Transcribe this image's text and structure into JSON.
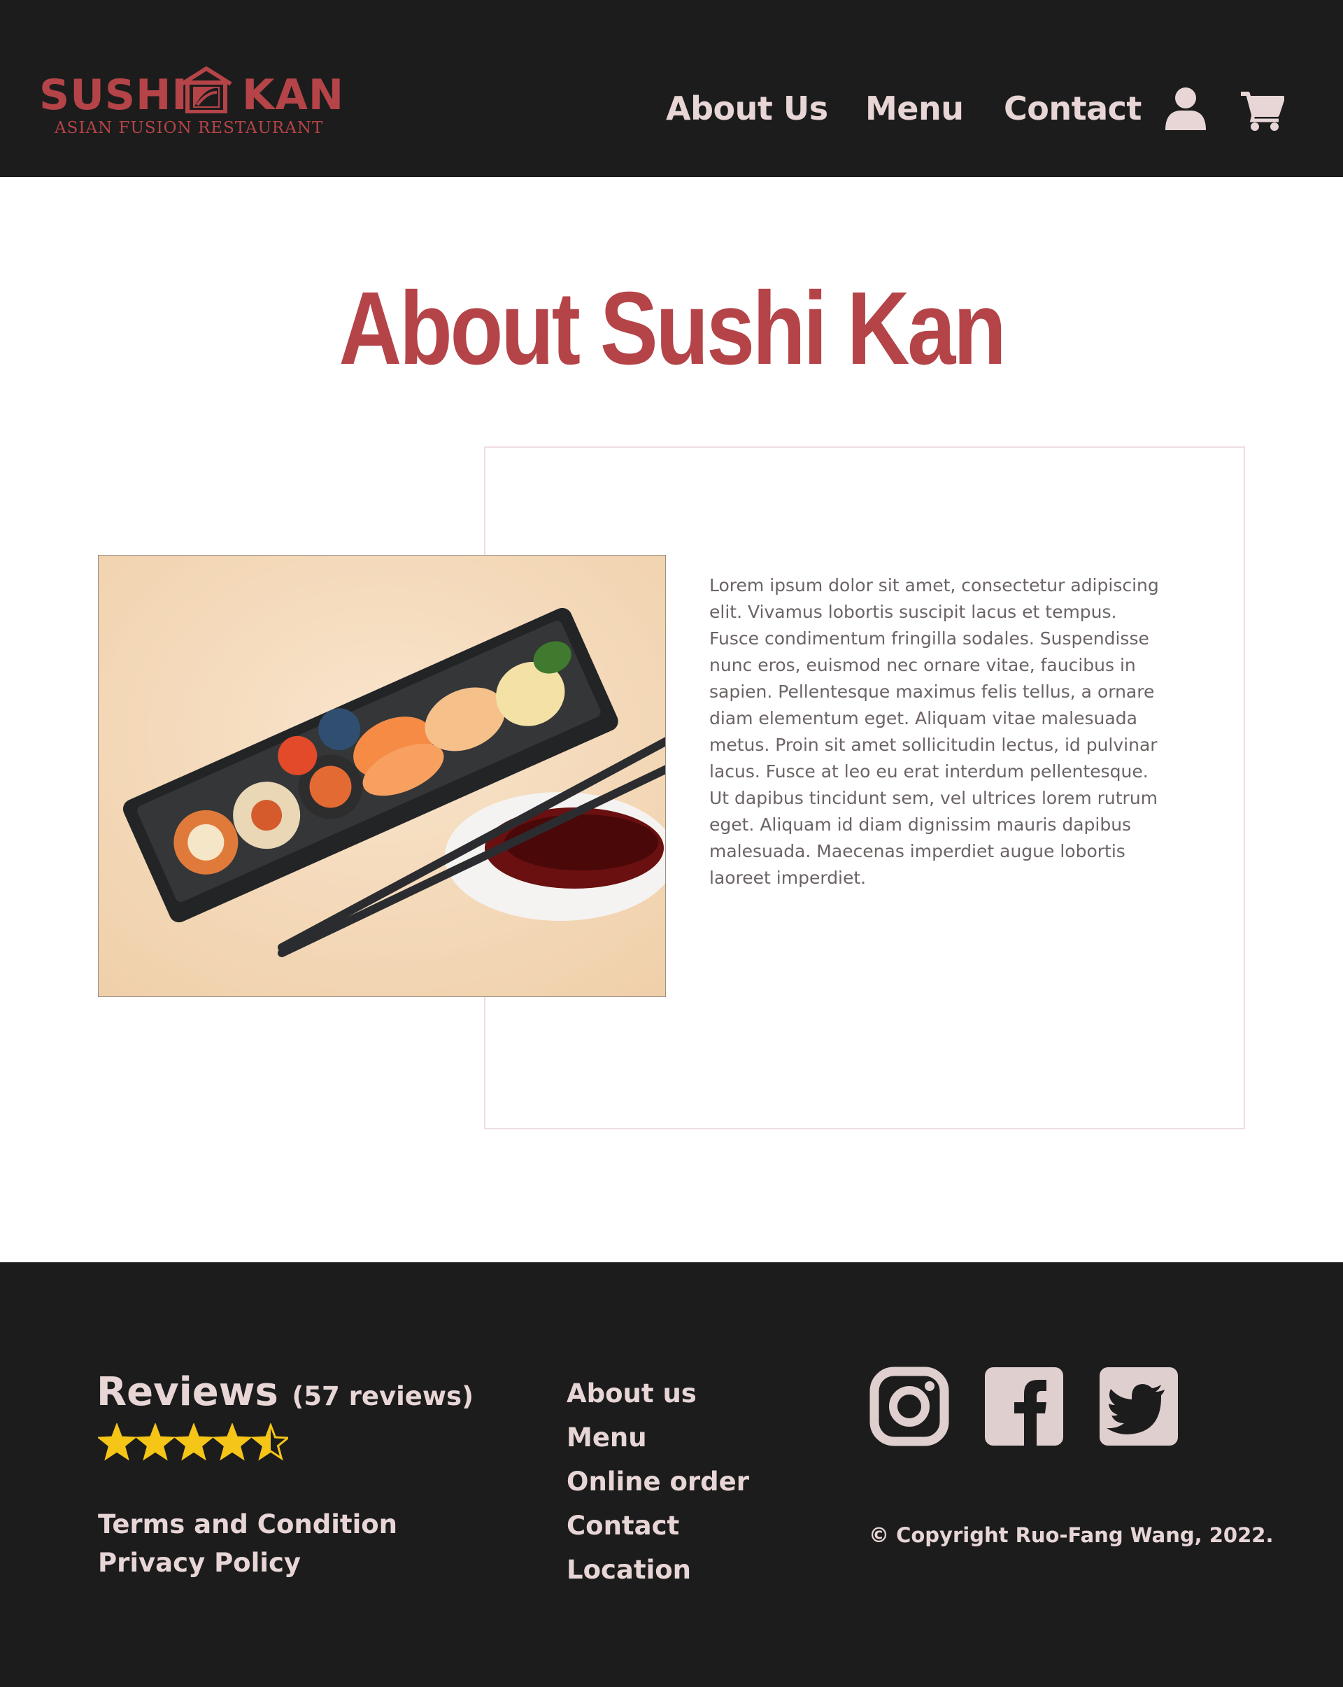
{
  "colors": {
    "header_bg": "#1c1c1c",
    "brand_red": "#b44448",
    "nav_text": "#e8d6d6",
    "star": "#f5c518",
    "body_text": "#6c6464"
  },
  "header": {
    "logo": {
      "word_left": "SUSHI",
      "word_right": "KAN",
      "tagline": "ASIAN FUSION RESTAURANT"
    },
    "nav": [
      {
        "label": "About Us"
      },
      {
        "label": "Menu"
      },
      {
        "label": "Contact"
      }
    ],
    "icons": [
      "user-icon",
      "cart-icon"
    ]
  },
  "main": {
    "title": "About Sushi Kan",
    "paragraph": "Lorem ipsum dolor sit amet, consectetur adipiscing elit. Vivamus lobortis suscipit lacus et tempus. Fusce condimentum fringilla sodales. Suspendisse nunc eros, euismod nec ornare vitae, faucibus in sapien. Pellentesque maximus felis tellus, a ornare diam elementum eget. Aliquam vitae malesuada metus. Proin sit amet sollicitudin lectus, id pulvinar lacus. Fusce at leo eu erat interdum pellentesque. Ut dapibus tincidunt sem, vel ultrices lorem rutrum eget. Aliquam id diam dignissim mauris dapibus malesuada. Maecenas imperdiet augue lobortis laoreet imperdiet."
  },
  "footer": {
    "reviews": {
      "title": "Reviews",
      "count": "(57 reviews)",
      "rating": 4.5,
      "max": 5
    },
    "legal": {
      "terms": "Terms and Condition",
      "privacy": "Privacy Policy"
    },
    "links": [
      {
        "label": "About us"
      },
      {
        "label": "Menu"
      },
      {
        "label": "Online order"
      },
      {
        "label": "Contact"
      },
      {
        "label": "Location"
      }
    ],
    "social": [
      "instagram-icon",
      "facebook-icon",
      "twitter-icon"
    ],
    "copyright": "© Copyright Ruo-Fang Wang, 2022."
  }
}
